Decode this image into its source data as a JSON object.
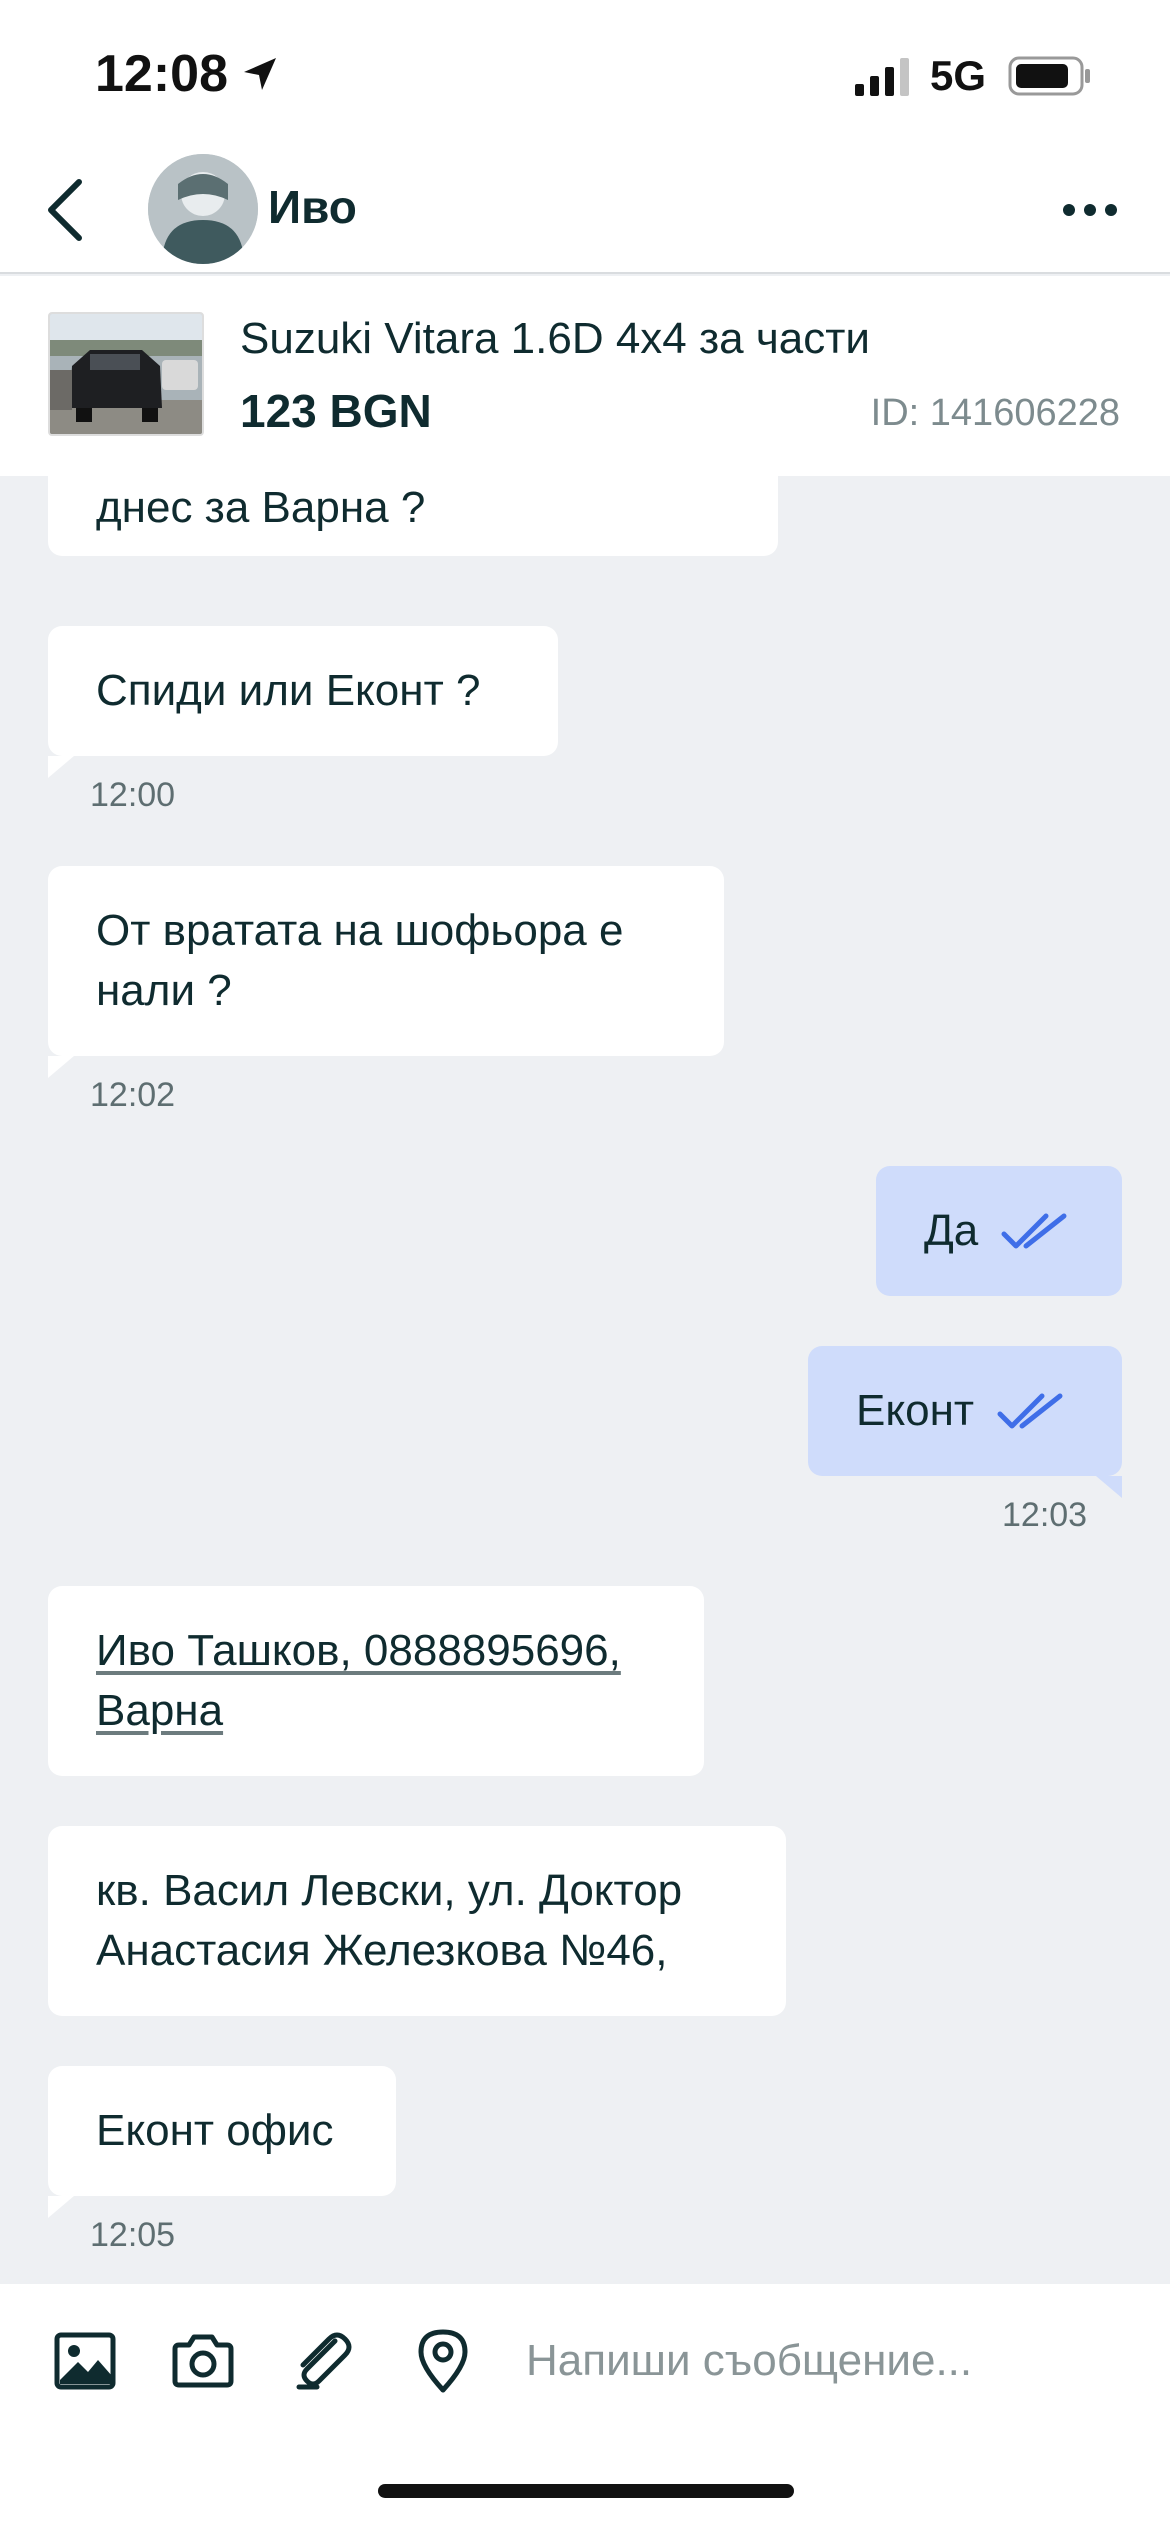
{
  "status_bar": {
    "time": "12:08",
    "network": "5G"
  },
  "header": {
    "contact_name": "Иво"
  },
  "ad": {
    "title": "Suzuki Vitara 1.6D 4x4 за части",
    "price": "123 BGN",
    "id_label": "ID: 141606228"
  },
  "messages": [
    {
      "direction": "in",
      "lines": [
        "днес за Варна ?"
      ],
      "time": ""
    },
    {
      "direction": "in",
      "lines": [
        "Спиди или Еконт ?"
      ],
      "time": "12:00"
    },
    {
      "direction": "in",
      "lines": [
        "От вратата на шофьора е",
        "нали ?"
      ],
      "time": "12:02"
    },
    {
      "direction": "out",
      "lines": [
        "Да"
      ],
      "time": "",
      "status": "read"
    },
    {
      "direction": "out",
      "lines": [
        "Еконт"
      ],
      "time": "12:03",
      "status": "read"
    },
    {
      "direction": "in",
      "lines": [
        "Иво Ташков, 0888895696,",
        "Варна"
      ],
      "time": "",
      "link": true
    },
    {
      "direction": "in",
      "lines": [
        "кв. Васил Левски, ул. Доктор",
        "Анастасия Железкова №46,"
      ],
      "time": ""
    },
    {
      "direction": "in",
      "lines": [
        "Еконт офис"
      ],
      "time": "12:05"
    }
  ],
  "composer": {
    "placeholder": "Напиши съобщение..."
  },
  "colors": {
    "incoming_bubble": "#ffffff",
    "outgoing_bubble": "#cfdcfb",
    "read_check": "#3f6ee8",
    "chat_background": "#eef0f3",
    "text": "#0f2b2f"
  },
  "icons": [
    "back-chevron-icon",
    "more-dots-icon",
    "image-icon",
    "camera-icon",
    "attach-icon",
    "location-pin-icon",
    "location-arrow-icon",
    "signal-icon",
    "battery-icon"
  ]
}
